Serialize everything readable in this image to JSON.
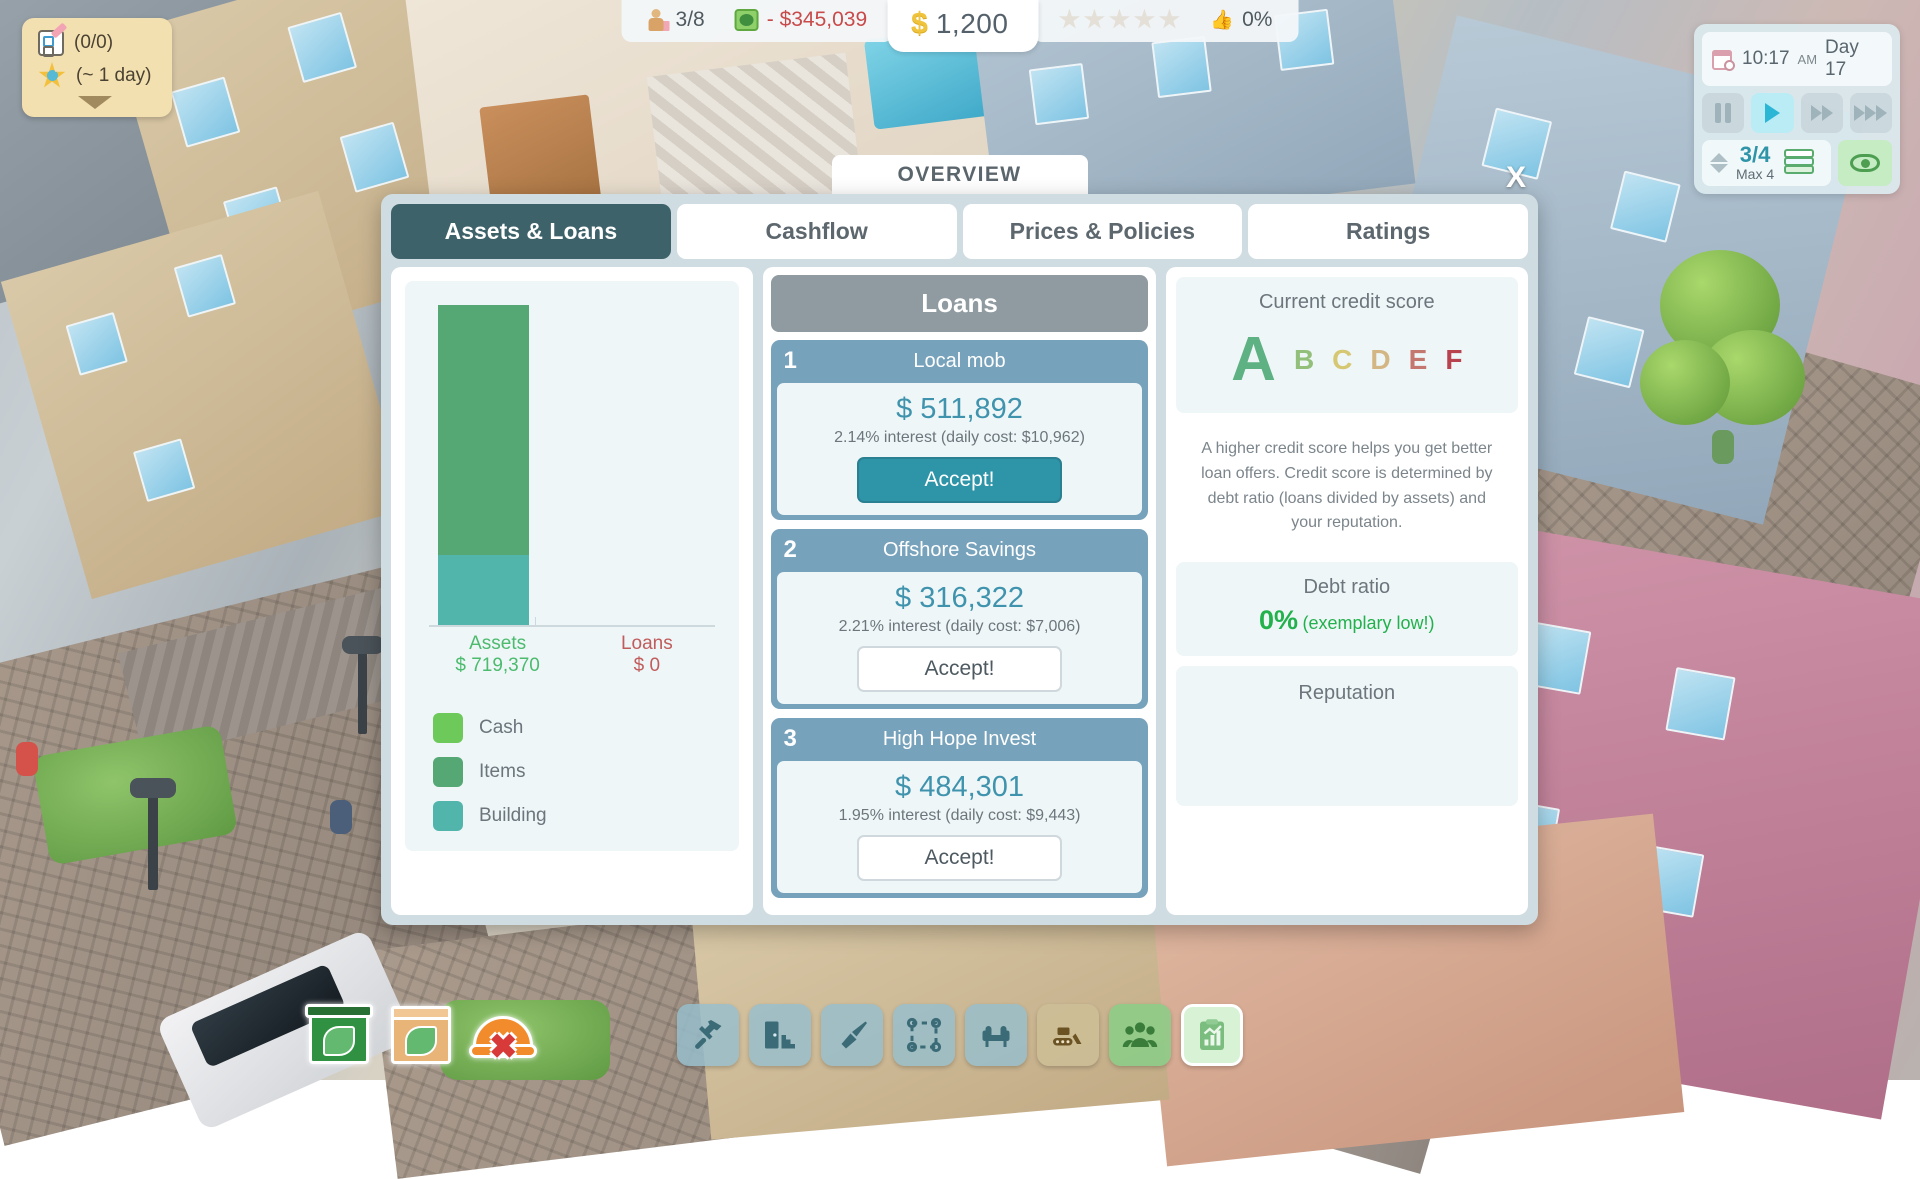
{
  "hud": {
    "staff": {
      "icon": "person-briefcase-icon",
      "value": "3/8"
    },
    "cashflow": {
      "icon": "money-recycle-icon",
      "value": "- $345,039"
    },
    "money": {
      "icon": "dollar-icon",
      "value": "1,200"
    },
    "stars": {
      "icon": "star-icon",
      "count": 5,
      "filled": 0
    },
    "approval": {
      "icon": "thumbs-up-icon",
      "value": "0%"
    }
  },
  "quest_panel": {
    "tasks_icon": "clipboard-pencil-icon",
    "tasks_value": "(0/0)",
    "time_icon": "star-magnifier-icon",
    "time_value": "(~ 1 day)",
    "collapse_icon": "caret-down-icon"
  },
  "time_panel": {
    "calendar_icon": "calendar-clock-icon",
    "time": "10:17",
    "ampm": "AM",
    "day": "Day 17",
    "speed_buttons": [
      {
        "name": "pause-button",
        "icon": "pause-icon",
        "active": false
      },
      {
        "name": "play-button",
        "icon": "play-icon",
        "active": true
      },
      {
        "name": "fast-forward-button",
        "icon": "fast-forward-icon",
        "active": false
      },
      {
        "name": "ultra-speed-button",
        "icon": "ultra-forward-icon",
        "active": false
      }
    ],
    "floor_current": "3/4",
    "floor_max": "Max 4",
    "layers_icon": "layers-icon",
    "visibility_icon": "eye-icon"
  },
  "dialog": {
    "title": "OVERVIEW",
    "close_label": "X",
    "tabs": [
      {
        "label": "Assets & Loans",
        "active": true
      },
      {
        "label": "Cashflow",
        "active": false
      },
      {
        "label": "Prices & Policies",
        "active": false
      },
      {
        "label": "Ratings",
        "active": false
      }
    ]
  },
  "chart_data": {
    "type": "bar",
    "title": "",
    "xlabel": "",
    "ylabel": "",
    "categories": [
      "Assets",
      "Loans"
    ],
    "values": [
      719370,
      0
    ],
    "value_labels": [
      "$ 719,370",
      "$ 0"
    ],
    "category_label_colors": [
      "#4cbb6e",
      "#c15c5c"
    ],
    "stacked": true,
    "series": [
      {
        "name": "Cash",
        "color": "#6dc95a",
        "values": [
          0,
          0
        ]
      },
      {
        "name": "Items",
        "color": "#55a873",
        "values": [
          494370,
          0
        ]
      },
      {
        "name": "Building",
        "color": "#52b5ac",
        "values": [
          225000,
          0
        ]
      }
    ],
    "legend": [
      {
        "label": "Cash",
        "color": "#6dc95a"
      },
      {
        "label": "Items",
        "color": "#55a873"
      },
      {
        "label": "Building",
        "color": "#52b5ac"
      }
    ],
    "grid": false,
    "legend_position": "bottom-left",
    "ylim": [
      0,
      800000
    ]
  },
  "loans": {
    "header": "Loans",
    "offers": [
      {
        "number": "1",
        "lender": "Local mob",
        "amount": "$ 511,892",
        "interest": "2.14% interest (daily cost: $10,962)",
        "accept_label": "Accept!",
        "highlighted": true
      },
      {
        "number": "2",
        "lender": "Offshore Savings",
        "amount": "$ 316,322",
        "interest": "2.21% interest (daily cost: $7,006)",
        "accept_label": "Accept!",
        "highlighted": false
      },
      {
        "number": "3",
        "lender": "High Hope Invest",
        "amount": "$ 484,301",
        "interest": "1.95% interest (daily cost: $9,443)",
        "accept_label": "Accept!",
        "highlighted": false
      }
    ]
  },
  "credit": {
    "score_title": "Current credit score",
    "grades": [
      {
        "letter": "A",
        "color": "#5eb183",
        "current": true
      },
      {
        "letter": "B",
        "color": "#92c07a",
        "current": false
      },
      {
        "letter": "C",
        "color": "#d6c773",
        "current": false
      },
      {
        "letter": "D",
        "color": "#d4b684",
        "current": false
      },
      {
        "letter": "E",
        "color": "#c4776e",
        "current": false
      },
      {
        "letter": "F",
        "color": "#b8434f",
        "current": false
      }
    ],
    "description": "A higher credit score helps you get better loan offers. Credit score is determined by debt ratio (loans divided by assets) and your reputation.",
    "debt_title": "Debt ratio",
    "debt_value": "0%",
    "debt_note": "(exemplary low!)",
    "debt_color": "#22b14c",
    "reputation_title": "Reputation"
  },
  "left_tools": [
    {
      "name": "recycle-bin-tool",
      "icon": "recycle-bin-icon"
    },
    {
      "name": "storage-box-tool",
      "icon": "cardboard-box-icon"
    },
    {
      "name": "construction-stop-tool",
      "icon": "hard-hat-x-icon"
    }
  ],
  "toolbar": [
    {
      "name": "build-tool",
      "icon": "hammer-icon",
      "active": false,
      "theme": "blue"
    },
    {
      "name": "door-stairs-tool",
      "icon": "door-stairs-icon",
      "active": false,
      "theme": "blue"
    },
    {
      "name": "paint-tool",
      "icon": "paint-brush-icon",
      "active": false,
      "theme": "blue"
    },
    {
      "name": "select-area-tool",
      "icon": "dashed-selection-icon",
      "active": false,
      "theme": "blue"
    },
    {
      "name": "furniture-tool",
      "icon": "armchair-icon",
      "active": false,
      "theme": "blue"
    },
    {
      "name": "demolish-tool",
      "icon": "bulldozer-icon",
      "active": false,
      "theme": "tan"
    },
    {
      "name": "staff-tool",
      "icon": "people-icon",
      "active": false,
      "theme": "green"
    },
    {
      "name": "overview-tool",
      "icon": "clipboard-chart-icon",
      "active": true,
      "theme": "green"
    }
  ],
  "colors": {
    "accent": "#2e94a8",
    "tab_active": "#3e6269",
    "panel_bg": "#cfdde2",
    "loan_card": "#77a2bb",
    "positive": "#22b14c",
    "negative": "#c94a4a"
  }
}
